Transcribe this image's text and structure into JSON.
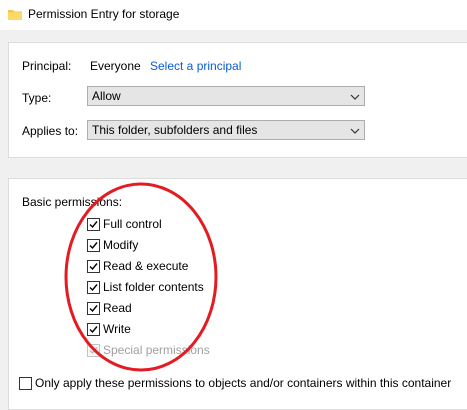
{
  "window": {
    "title": "Permission Entry for storage",
    "title_icon": "folder-icon"
  },
  "principal": {
    "label": "Principal:",
    "value": "Everyone",
    "link": "Select a principal"
  },
  "type": {
    "label": "Type:",
    "value": "Allow"
  },
  "applies_to": {
    "label": "Applies to:",
    "value": "This folder, subfolders and files"
  },
  "basic_permissions": {
    "label": "Basic permissions:",
    "items": [
      {
        "label": "Full control",
        "checked": true,
        "enabled": true
      },
      {
        "label": "Modify",
        "checked": true,
        "enabled": true
      },
      {
        "label": "Read & execute",
        "checked": true,
        "enabled": true
      },
      {
        "label": "List folder contents",
        "checked": true,
        "enabled": true
      },
      {
        "label": "Read",
        "checked": true,
        "enabled": true
      },
      {
        "label": "Write",
        "checked": true,
        "enabled": true
      },
      {
        "label": "Special permissions",
        "checked": true,
        "enabled": false
      }
    ]
  },
  "apply_only": {
    "label": "Only apply these permissions to objects and/or containers within this container",
    "checked": false
  },
  "colors": {
    "link": "#0b5bd7",
    "highlight": "#e31b23"
  }
}
